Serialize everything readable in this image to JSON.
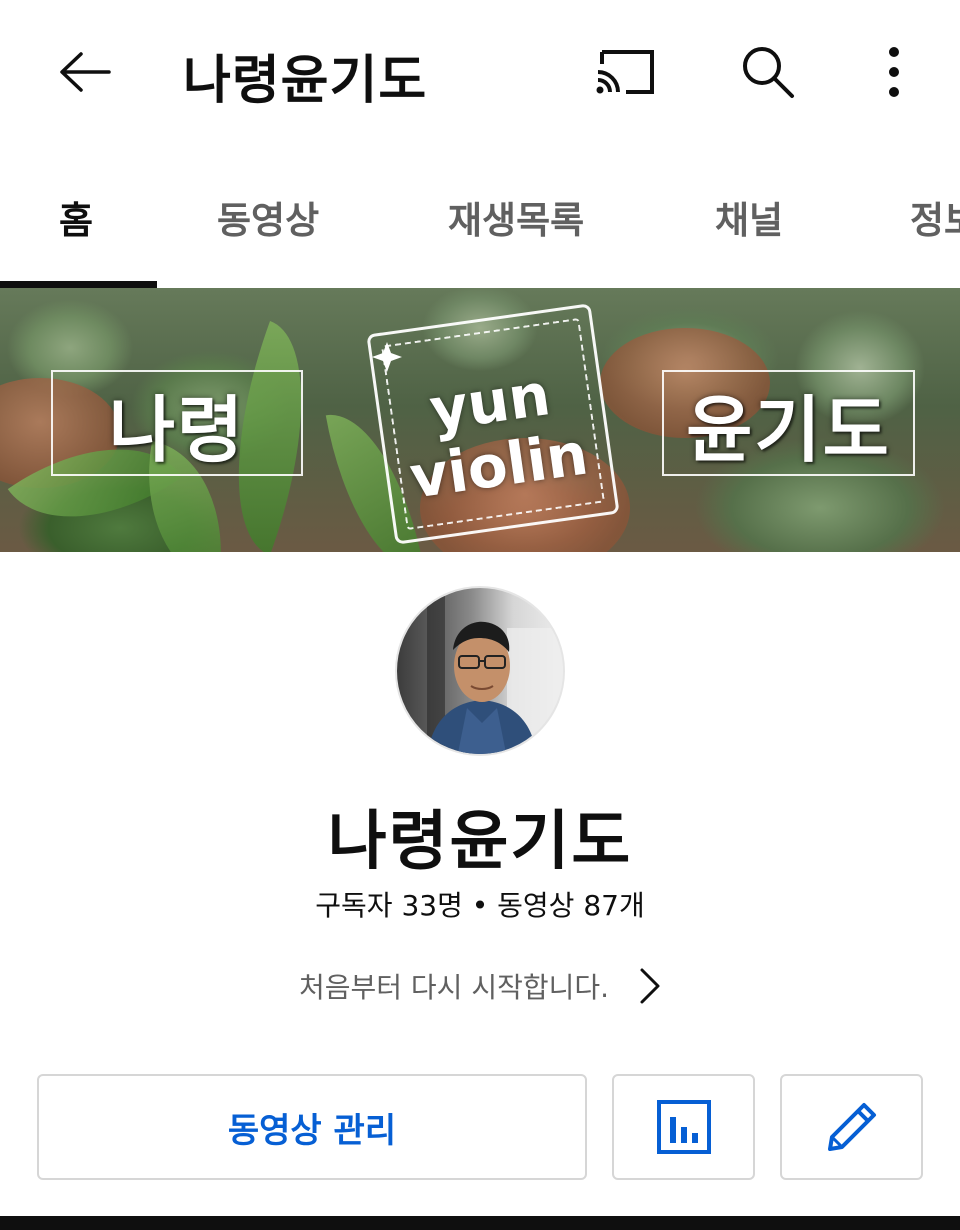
{
  "header": {
    "title": "나령윤기도",
    "icons": [
      "back-arrow-icon",
      "cast-icon",
      "search-icon",
      "more-vert-icon"
    ]
  },
  "tabs": [
    {
      "label": "홈",
      "active": true
    },
    {
      "label": "동영상",
      "active": false
    },
    {
      "label": "재생목록",
      "active": false
    },
    {
      "label": "채널",
      "active": false
    },
    {
      "label": "정보",
      "active": false
    }
  ],
  "banner": {
    "left_text": "나령",
    "stamp_line1": "yun",
    "stamp_line2": "violin",
    "right_text": "윤기도"
  },
  "channel": {
    "name": "나령윤기도",
    "stats": "구독자 33명 • 동영상 87개",
    "description": "처음부터 다시 시작합니다."
  },
  "actions": {
    "manage_label": "동영상 관리",
    "analytics_icon": "bar-chart-icon",
    "edit_icon": "pencil-icon"
  },
  "colors": {
    "accent": "#065fd4",
    "text_primary": "#0f0f0f",
    "text_secondary": "#606060",
    "border": "#d6d6d6"
  }
}
